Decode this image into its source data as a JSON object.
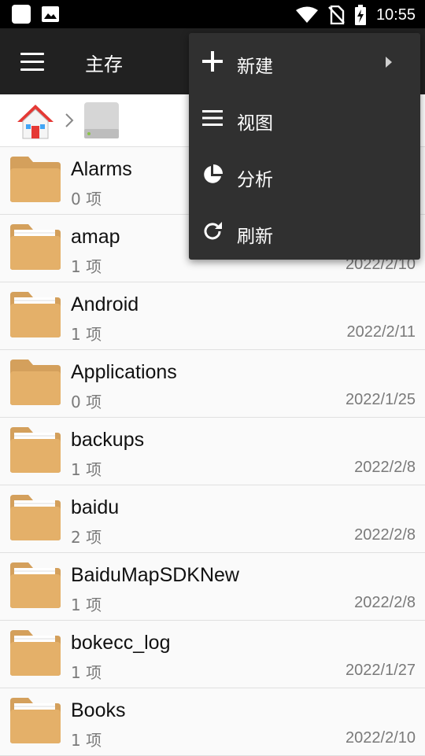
{
  "status_bar": {
    "time": "10:55"
  },
  "toolbar": {
    "title": "主存"
  },
  "menu": {
    "items": [
      {
        "label": "新建",
        "icon": "plus-icon",
        "has_submenu": true
      },
      {
        "label": "视图",
        "icon": "list-view-icon"
      },
      {
        "label": "分析",
        "icon": "pie-chart-icon"
      },
      {
        "label": "刷新",
        "icon": "refresh-icon"
      }
    ]
  },
  "files": [
    {
      "name": "Alarms",
      "count": "0 项",
      "date": ""
    },
    {
      "name": "amap",
      "count": "1 项",
      "date": "2022/2/10"
    },
    {
      "name": "Android",
      "count": "1 项",
      "date": "2022/2/11"
    },
    {
      "name": "Applications",
      "count": "0 项",
      "date": "2022/1/25"
    },
    {
      "name": "backups",
      "count": "1 项",
      "date": "2022/2/8"
    },
    {
      "name": "baidu",
      "count": "2 项",
      "date": "2022/2/8"
    },
    {
      "name": "BaiduMapSDKNew",
      "count": "1 项",
      "date": "2022/2/8"
    },
    {
      "name": "bokecc_log",
      "count": "1 项",
      "date": "2022/1/27"
    },
    {
      "name": "Books",
      "count": "1 项",
      "date": "2022/2/10"
    }
  ],
  "colors": {
    "folder": "#E4B069",
    "folder_tab": "#D4A05C",
    "toolbar": "#212121",
    "menu": "#303030"
  }
}
